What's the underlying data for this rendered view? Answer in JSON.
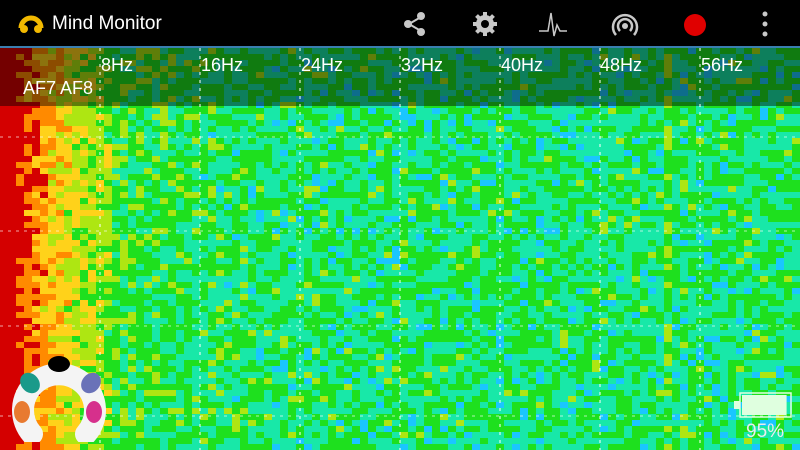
{
  "app": {
    "title": "Mind Monitor"
  },
  "toolbar": {
    "icons": [
      "share-icon",
      "settings-gear-icon",
      "waveform-icon",
      "stream-broadcast-icon",
      "record-icon",
      "overflow-menu-icon"
    ],
    "record_color": "#e00000"
  },
  "spectrogram": {
    "frequency_labels": [
      "8Hz",
      "16Hz",
      "24Hz",
      "32Hz",
      "40Hz",
      "48Hz",
      "56Hz"
    ],
    "frequency_values_hz": [
      8,
      16,
      24,
      32,
      40,
      48,
      56
    ],
    "channels_label": "AF7 AF8",
    "colormap": [
      "#d40000",
      "#ff8a00",
      "#ffd21a",
      "#aee612",
      "#1ee01e",
      "#18e8a8",
      "#1ac6ff"
    ],
    "gridlines": true
  },
  "headset_status": {
    "sensor_colors": [
      "#000000",
      "#1a9a8a",
      "#6a72b8",
      "#e87a30",
      "#d6308c"
    ]
  },
  "battery": {
    "level": 0.95,
    "text": "95%",
    "color": "#dfffdf"
  }
}
